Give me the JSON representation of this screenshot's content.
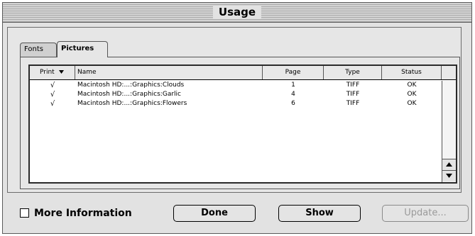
{
  "window": {
    "title": "Usage"
  },
  "tabs": [
    {
      "label": "Fonts",
      "selected": false
    },
    {
      "label": "Pictures",
      "selected": true
    }
  ],
  "list": {
    "columns": [
      "Print",
      "Name",
      "Page",
      "Type",
      "Status"
    ],
    "rows": [
      {
        "print": "√",
        "name": "Macintosh HD:...:Graphics:Clouds",
        "page": "1",
        "type": "TIFF",
        "status": "OK"
      },
      {
        "print": "√",
        "name": "Macintosh HD:...:Graphics:Garlic",
        "page": "4",
        "type": "TIFF",
        "status": "OK"
      },
      {
        "print": "√",
        "name": "Macintosh HD:...:Graphics:Flowers",
        "page": "6",
        "type": "TIFF",
        "status": "OK"
      }
    ]
  },
  "options": {
    "more_information_label": "More Information",
    "more_information_checked": false
  },
  "buttons": {
    "done": "Done",
    "show": "Show",
    "update": "Update...",
    "update_enabled": false
  },
  "colors": {
    "window_bg": "#e2e2e2",
    "list_bg": "#ffffff",
    "disabled_text": "#9a9a9a"
  }
}
